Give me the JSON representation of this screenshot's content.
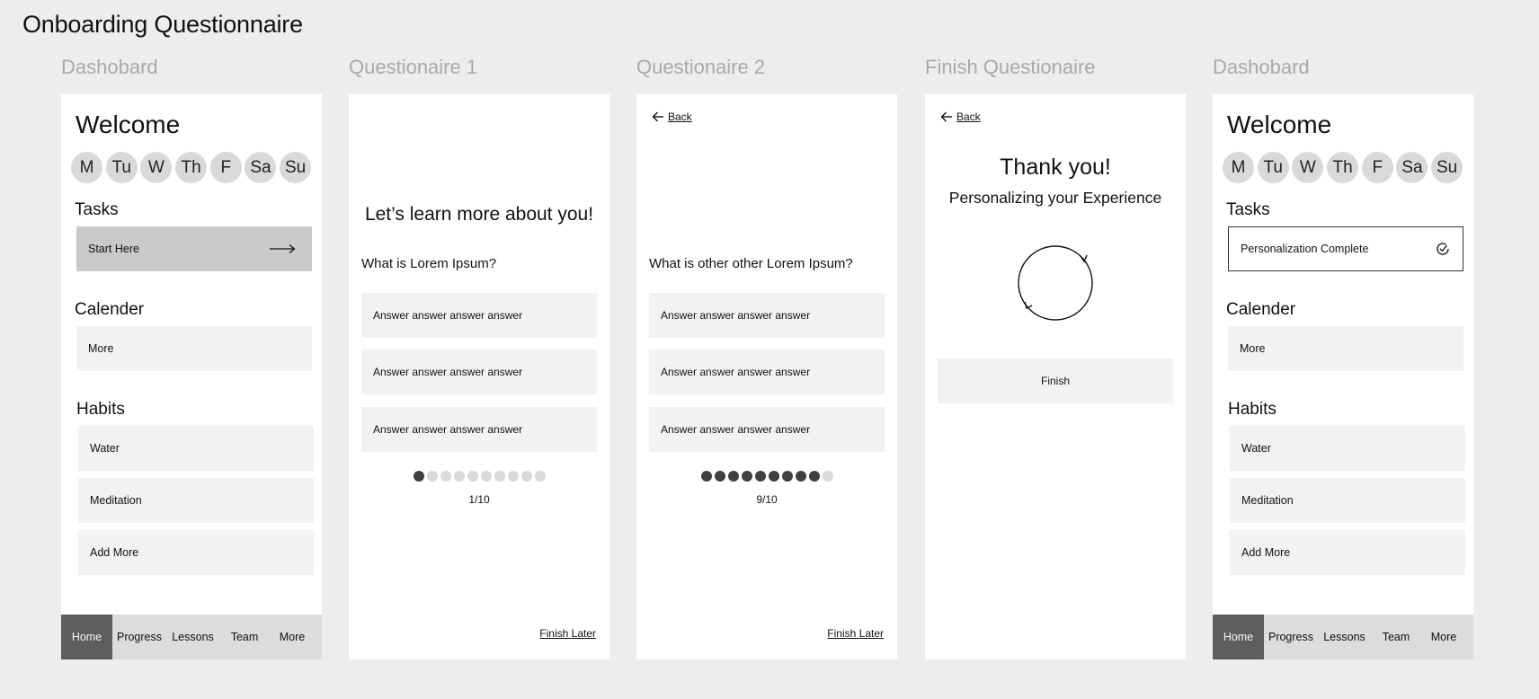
{
  "page_title": "Onboarding Questionnaire",
  "frames": [
    {
      "label": "Dashobard",
      "welcome": "Welcome",
      "days": [
        "M",
        "Tu",
        "W",
        "Th",
        "F",
        "Sa",
        "Su"
      ],
      "tasks_title": "Tasks",
      "task": {
        "label": "Start Here",
        "icon": "arrow-right-icon"
      },
      "calendar_title": "Calender",
      "calendar_item": "More",
      "habits_title": "Habits",
      "habits": [
        "Water",
        "Meditation",
        "Add More"
      ],
      "nav": [
        "Home",
        "Progress",
        "Lessons",
        "Team",
        "More"
      ],
      "nav_active": "Home"
    },
    {
      "label": "Questionaire 1",
      "heading": "Let’s learn more about you!",
      "question": "What is Lorem Ipsum?",
      "answers": [
        "Answer answer answer answer",
        "Answer answer answer answer",
        "Answer answer answer answer"
      ],
      "progress": {
        "current": 1,
        "total": 10,
        "text": "1/10"
      },
      "finish_later": "Finish Later"
    },
    {
      "label": "Questionaire 2",
      "back": "Back",
      "question": "What is other other Lorem Ipsum?",
      "answers": [
        "Answer answer answer answer",
        "Answer answer answer answer",
        "Answer answer answer answer"
      ],
      "progress": {
        "current": 9,
        "total": 10,
        "text": "9/10"
      },
      "finish_later": "Finish Later"
    },
    {
      "label": "Finish Questionaire",
      "back": "Back",
      "thanks": "Thank you!",
      "subtitle": "Personalizing your Experience",
      "spinner_icon": "refresh-icon",
      "finish_button": "Finish"
    },
    {
      "label": "Dashobard",
      "welcome": "Welcome",
      "days": [
        "M",
        "Tu",
        "W",
        "Th",
        "F",
        "Sa",
        "Su"
      ],
      "tasks_title": "Tasks",
      "task": {
        "label": "Personalization Complete",
        "icon": "check-circle-icon"
      },
      "calendar_title": "Calender",
      "calendar_item": "More",
      "habits_title": "Habits",
      "habits": [
        "Water",
        "Meditation",
        "Add More"
      ],
      "nav": [
        "Home",
        "Progress",
        "Lessons",
        "Team",
        "More"
      ],
      "nav_active": "Home"
    }
  ],
  "colors": {
    "background": "#ededed",
    "frame": "#ffffff",
    "card": "#f2f2f2",
    "task_pending": "#c9c9c9",
    "nav_bar": "#dcdcdc",
    "nav_active": "#5e5e5e",
    "dot_active": "#404040",
    "dot_inactive": "#d9d9d9",
    "frame_label": "#a9a9a9"
  }
}
